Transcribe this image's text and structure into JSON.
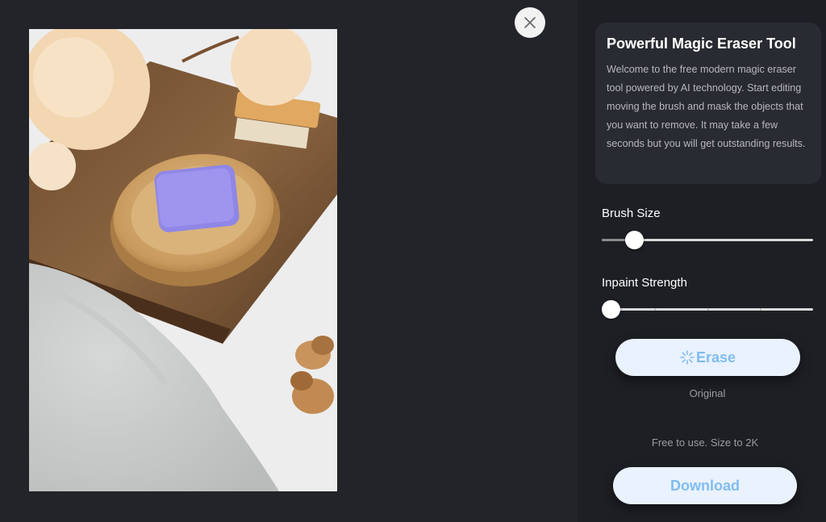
{
  "close": {
    "icon": "close-icon"
  },
  "image": {
    "alt": "Lavender soap bar on a wooden dish with flowers, brush, acorns and towel"
  },
  "panel": {
    "title": "Powerful Magic Eraser Tool",
    "description": "Welcome to the free modern magic eraser tool powered by AI technology. Start editing moving the brush and mask the objects that you want to remove. It may take a few seconds but you will get outstanding results.",
    "brush_size": {
      "label": "Brush Size",
      "value_fraction": 0.12
    },
    "inpaint_strength": {
      "label": "Inpaint Strength",
      "value_fraction": 0.0
    },
    "erase_button": {
      "label": "Erase",
      "icon": "spinner-icon"
    },
    "original_label": "Original",
    "free_note": "Free to use. Size to 2K",
    "download_button": {
      "label": "Download"
    }
  },
  "colors": {
    "accent": "#7fbdf0",
    "panel_bg": "#1d1f24",
    "stage_bg": "#222429",
    "button_bg": "#eaf2ff"
  }
}
